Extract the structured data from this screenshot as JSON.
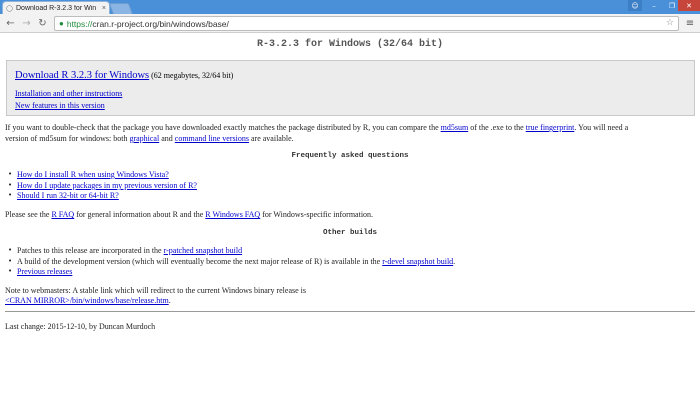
{
  "browser": {
    "tab_title": "Download R-3.2.3 for Win",
    "tab_close": "×",
    "url_scheme": "https://",
    "url_rest": "cran.r-project.org/bin/windows/base/",
    "controls": {
      "user": "☺",
      "minimize": "–",
      "maximize": "❐",
      "close": "✕"
    },
    "nav": {
      "back": "←",
      "forward": "→",
      "reload": "↻",
      "menu": "≡",
      "star": "☆",
      "lock": "🔒"
    }
  },
  "page": {
    "title": "R-3.2.3 for Windows (32/64 bit)",
    "download": {
      "link_label": "Download R 3.2.3 for Windows",
      "size_note": " (62 megabytes, 32/64 bit)",
      "install_link": "Installation and other instructions",
      "features_link": "New features in this version"
    },
    "checksum_para": {
      "part1": "If you want to double-check that the package you have downloaded exactly matches the package distributed by R, you can compare the ",
      "md5_link": "md5sum",
      "part2": " of the .exe to the ",
      "fingerprint_link": "true fingerprint",
      "part3": ". You will need a",
      "line2_part1": "version of md5sum for windows: both ",
      "graphical_link": "graphical",
      "and": " and ",
      "cmdline_link": "command line versions",
      "line2_end": " are available."
    },
    "faq_heading": "Frequently asked questions",
    "faq_items": [
      "How do I install R when using Windows Vista?",
      "How do I update packages in my previous version of R?",
      "Should I run 32-bit or 64-bit R?"
    ],
    "faq_para": {
      "part1": "Please see the ",
      "rfaq_link": "R FAQ",
      "part2": " for general information about R and the ",
      "winfaq_link": "R Windows FAQ",
      "part3": " for Windows-specific information."
    },
    "other_heading": "Other builds",
    "other_items": {
      "patches_text": "Patches to this release are incorporated in the ",
      "patches_link": "r-patched snapshot build",
      "devel_text": "A build of the development version (which will eventually become the next major release of R) is available in the ",
      "devel_link": "r-devel snapshot build",
      "devel_end": ".",
      "previous_link": "Previous releases"
    },
    "webmaster": {
      "line1": "Note to webmasters: A stable link which will redirect to the current Windows binary release is",
      "link": "<CRAN MIRROR>/bin/windows/base/release.htm",
      "end": "."
    },
    "last_change": "Last change: 2015-12-10, by Duncan Murdoch"
  }
}
